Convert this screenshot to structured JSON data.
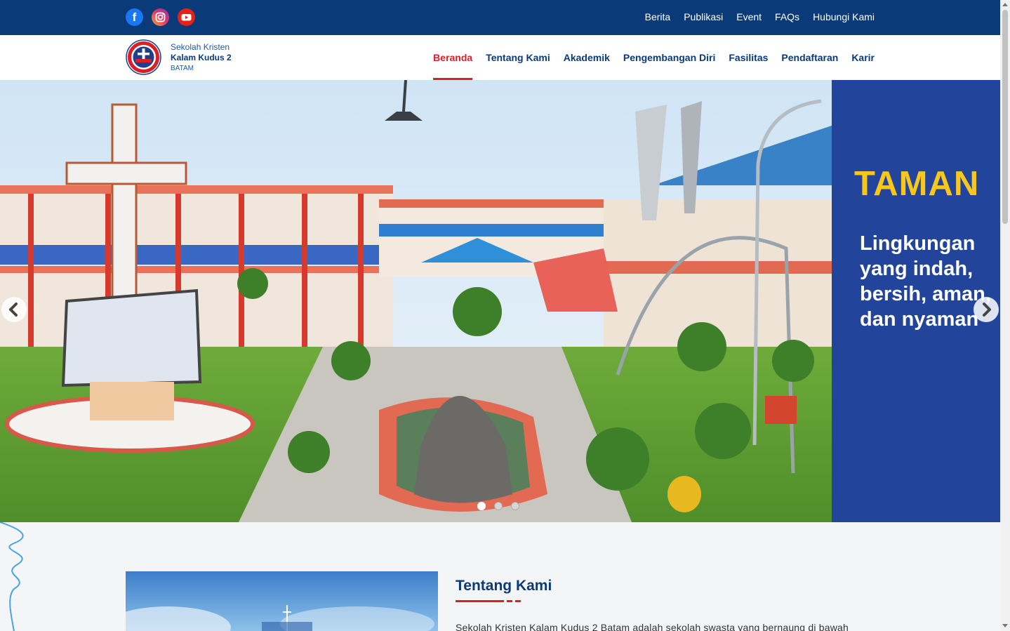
{
  "social": {
    "facebook_letter": "f"
  },
  "top_nav": [
    "Berita",
    "Publikasi",
    "Event",
    "FAQs",
    "Hubungi Kami"
  ],
  "brand": {
    "line1": "Sekolah Kristen",
    "line2": "Kalam Kudus 2",
    "line3": "BATAM"
  },
  "main_nav": {
    "items": [
      "Beranda",
      "Tentang Kami",
      "Akademik",
      "Pengembangan Diri",
      "Fasilitas",
      "Pendaftaran",
      "Karir"
    ],
    "active": "Beranda"
  },
  "hero": {
    "title": "TAMAN",
    "text": "Lingkungan yang indah, bersih, aman, dan nyaman",
    "slide_count": 3,
    "active_slide": 1
  },
  "about": {
    "title": "Tentang Kami",
    "text": "Sekolah Kristen Kalam Kudus 2 Batam adalah sekolah swasta yang bernaung di bawah"
  },
  "colors": {
    "navy": "#0b3a78",
    "accent_red": "#d92027",
    "panel_blue": "#22449a",
    "hero_yellow": "#f7c71e"
  }
}
